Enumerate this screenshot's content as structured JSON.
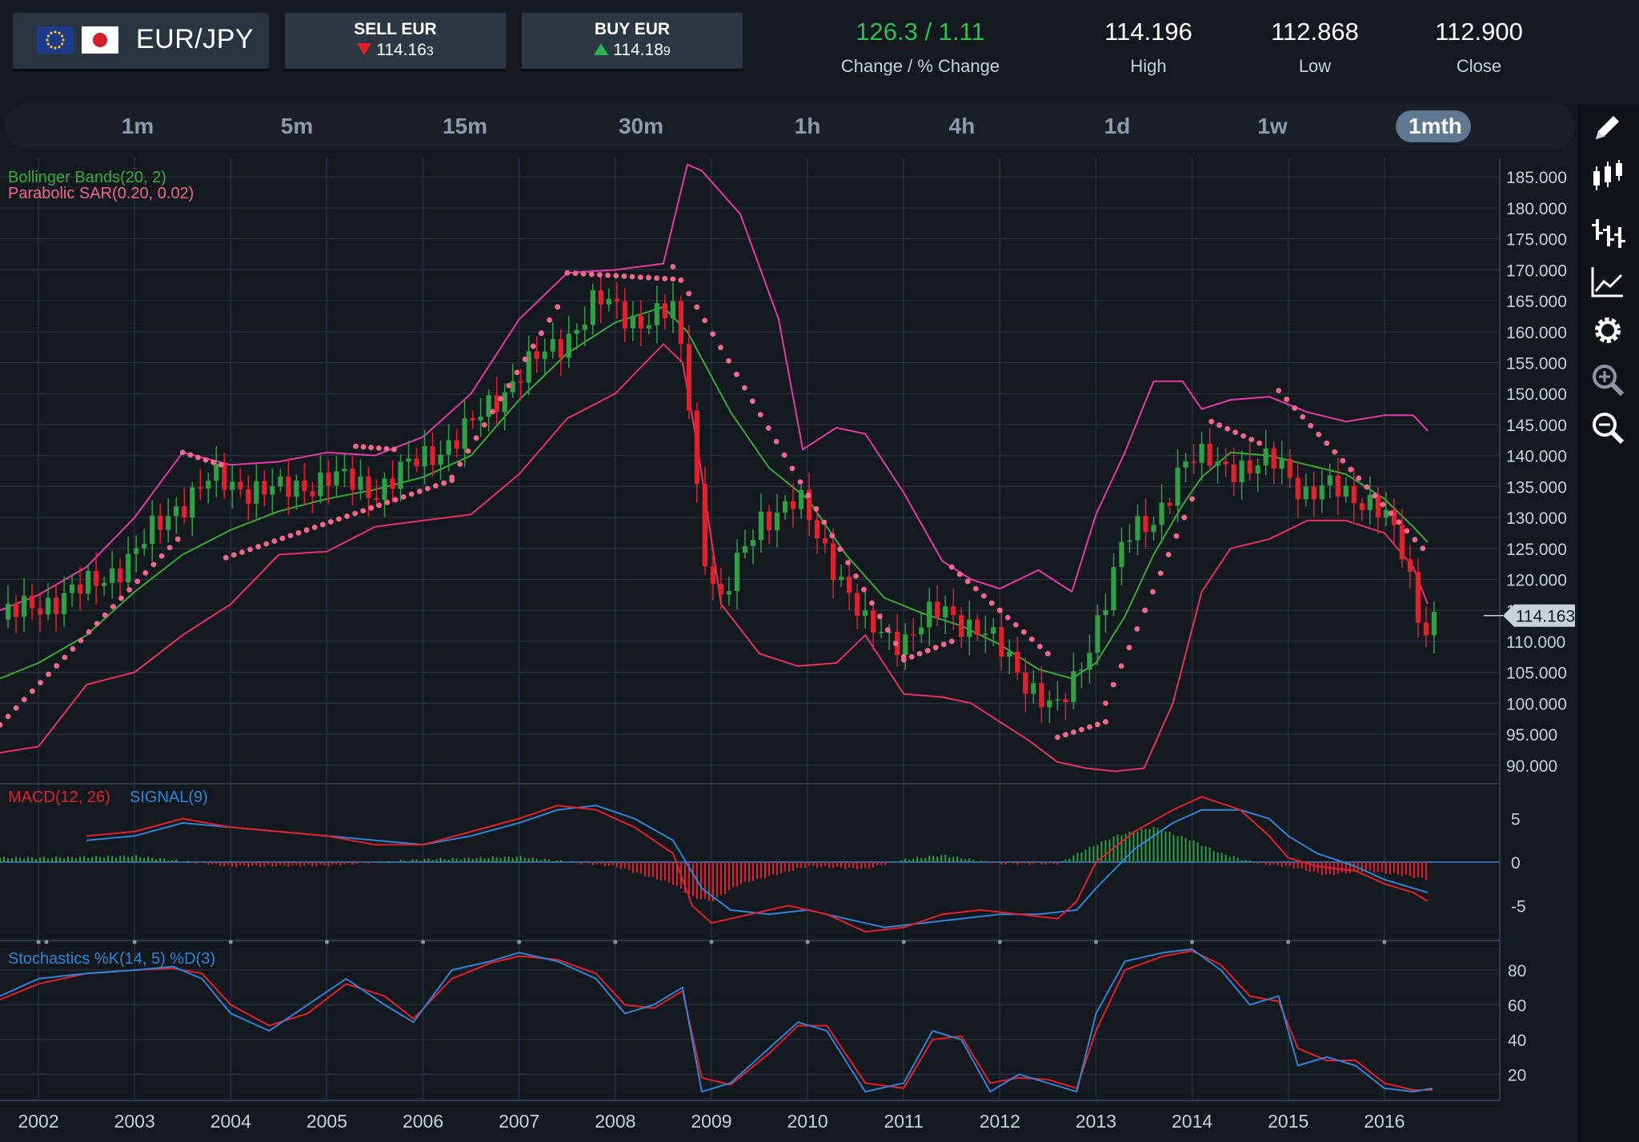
{
  "header": {
    "pair": "EUR/JPY",
    "flags": [
      "eu-flag-icon",
      "jp-flag-icon"
    ],
    "sell": {
      "label": "SELL EUR",
      "price": "114.16",
      "pip": "3"
    },
    "buy": {
      "label": "BUY EUR",
      "price": "114.18",
      "pip": "9"
    },
    "stats": [
      {
        "value": "126.3 / 1.11",
        "label": "Change / % Change",
        "color": "#2fbf5a"
      },
      {
        "value": "114.196",
        "label": "High"
      },
      {
        "value": "112.868",
        "label": "Low"
      },
      {
        "value": "112.900",
        "label": "Close"
      }
    ]
  },
  "timeframes": [
    "1m",
    "5m",
    "15m",
    "30m",
    "1h",
    "4h",
    "1d",
    "1w",
    "1mth"
  ],
  "active_timeframe": "1mth",
  "tools": [
    "pencil-icon",
    "candlestick-icon",
    "ohlc-bars-icon",
    "line-chart-icon",
    "gear-icon",
    "zoom-in-icon",
    "zoom-out-icon"
  ],
  "colors": {
    "up": "#2fa043",
    "down": "#e5202c",
    "bollinger_outer": "#e83aa6",
    "bollinger_mid": "#3caa36",
    "bollinger_lower": "#e8335f",
    "sar": "#f06a8c",
    "macd": "#e5202c",
    "signal": "#2f86d8",
    "stoch_k": "#2f86d8",
    "stoch_d": "#e5202c",
    "grid": "#2a3443",
    "background": "#14181f"
  },
  "chart_data": [
    {
      "type": "candlestick",
      "title": "Bollinger Bands(20, 2)",
      "subtitle": "Parabolic SAR(0.20, 0.02)",
      "indicators": [
        "Bollinger Bands(20, 2)",
        "Parabolic SAR(0.20, 0.02)"
      ],
      "x_ticks": [
        "2002",
        "2003",
        "2004",
        "2005",
        "2006",
        "2007",
        "2008",
        "2009",
        "2010",
        "2011",
        "2012",
        "2013",
        "2014",
        "2015",
        "2016"
      ],
      "y_ticks": [
        "185.000",
        "180.000",
        "175.000",
        "170.000",
        "165.000",
        "160.000",
        "155.000",
        "150.000",
        "145.000",
        "140.000",
        "135.000",
        "130.000",
        "125.000",
        "120.000",
        "115.000",
        "110.000",
        "105.000",
        "100.000",
        "95.000",
        "90.000"
      ],
      "ylim": [
        87,
        188
      ],
      "xlim": [
        2001.6,
        2017.2
      ],
      "last_price_label": "114.163",
      "last_price": 114.163,
      "close_series": {
        "t": [
          2001.6,
          2002.0,
          2002.5,
          2003.0,
          2003.4,
          2003.8,
          2004.5,
          2005.0,
          2005.5,
          2006.0,
          2006.5,
          2007.0,
          2007.4,
          2007.8,
          2008.2,
          2008.6,
          2008.75,
          2008.9,
          2009.1,
          2009.5,
          2009.9,
          2010.3,
          2010.6,
          2011.0,
          2011.4,
          2011.8,
          2012.2,
          2012.6,
          2012.8,
          2013.0,
          2013.3,
          2013.6,
          2013.9,
          2014.2,
          2014.6,
          2014.9,
          2015.2,
          2015.5,
          2015.8,
          2016.0,
          2016.2,
          2016.4,
          2016.55
        ],
        "v": [
          113.5,
          116.0,
          118.5,
          124.0,
          131.5,
          136.0,
          134.0,
          136.5,
          134.5,
          139.5,
          144.5,
          153.5,
          157.5,
          165.0,
          162.0,
          163.0,
          152.0,
          126.0,
          116.0,
          130.0,
          132.5,
          122.0,
          112.0,
          110.5,
          115.0,
          112.0,
          105.0,
          98.5,
          104.0,
          113.0,
          126.0,
          130.0,
          138.0,
          140.0,
          137.0,
          140.0,
          133.0,
          135.0,
          133.0,
          130.0,
          124.0,
          112.0,
          114.2
        ]
      },
      "bollinger_upper": {
        "t": [
          2001.6,
          2002.0,
          2002.5,
          2003.0,
          2003.5,
          2004.0,
          2004.5,
          2005.0,
          2005.5,
          2006.0,
          2006.5,
          2007.0,
          2007.5,
          2008.0,
          2008.5,
          2008.75,
          2008.9,
          2009.3,
          2009.7,
          2009.95,
          2010.3,
          2010.6,
          2011.0,
          2011.4,
          2011.7,
          2012.0,
          2012.4,
          2012.75,
          2013.0,
          2013.3,
          2013.6,
          2013.9,
          2014.1,
          2014.4,
          2014.8,
          2015.2,
          2015.6,
          2016.0,
          2016.3,
          2016.45
        ],
        "v": [
          115.0,
          117.5,
          122.0,
          130.0,
          140.5,
          138.5,
          139.0,
          140.5,
          140.0,
          143.0,
          150.0,
          162.0,
          169.5,
          170.0,
          171.0,
          187.0,
          186.0,
          179.0,
          162.0,
          141.0,
          144.5,
          143.5,
          134.0,
          123.0,
          120.0,
          118.5,
          121.5,
          118.0,
          130.5,
          140.5,
          152.0,
          152.0,
          147.5,
          149.0,
          149.5,
          147.0,
          145.5,
          146.5,
          146.5,
          144.0
        ]
      },
      "bollinger_mid": {
        "t": [
          2001.6,
          2002.0,
          2002.5,
          2003.0,
          2003.5,
          2004.0,
          2004.5,
          2005.0,
          2005.5,
          2006.0,
          2006.5,
          2007.0,
          2007.5,
          2008.0,
          2008.5,
          2008.75,
          2009.2,
          2009.6,
          2010.0,
          2010.4,
          2010.8,
          2011.2,
          2011.6,
          2012.0,
          2012.4,
          2012.75,
          2013.0,
          2013.3,
          2013.6,
          2013.9,
          2014.1,
          2014.4,
          2014.8,
          2015.2,
          2015.6,
          2016.0,
          2016.3,
          2016.45
        ],
        "v": [
          104.0,
          106.5,
          111.0,
          118.0,
          124.0,
          128.0,
          131.0,
          133.0,
          134.5,
          136.5,
          140.0,
          149.0,
          156.5,
          161.5,
          164.0,
          160.0,
          147.0,
          138.0,
          133.0,
          124.0,
          117.0,
          114.5,
          112.5,
          109.5,
          105.5,
          104.0,
          106.5,
          114.0,
          124.0,
          132.0,
          136.5,
          140.5,
          140.0,
          138.5,
          137.0,
          133.0,
          128.5,
          126.0
        ]
      },
      "bollinger_lower": {
        "t": [
          2001.6,
          2002.0,
          2002.5,
          2003.0,
          2003.5,
          2004.0,
          2004.5,
          2005.0,
          2005.5,
          2006.0,
          2006.5,
          2007.0,
          2007.5,
          2008.0,
          2008.5,
          2008.7,
          2008.85,
          2009.1,
          2009.5,
          2009.9,
          2010.3,
          2010.6,
          2011.0,
          2011.4,
          2011.7,
          2012.0,
          2012.3,
          2012.6,
          2012.9,
          2013.2,
          2013.5,
          2013.8,
          2014.1,
          2014.4,
          2014.8,
          2015.2,
          2015.6,
          2016.0,
          2016.3,
          2016.45
        ],
        "v": [
          92.0,
          93.0,
          103.0,
          105.0,
          111.0,
          116.0,
          124.0,
          124.5,
          128.5,
          129.5,
          130.5,
          137.0,
          146.0,
          150.0,
          158.0,
          155.0,
          142.0,
          116.0,
          108.0,
          106.0,
          106.5,
          111.0,
          101.5,
          101.0,
          100.0,
          97.0,
          94.0,
          90.5,
          89.5,
          89.0,
          89.5,
          100.0,
          118.0,
          125.0,
          126.5,
          129.5,
          129.5,
          127.5,
          122.0,
          116.0
        ]
      },
      "sar": {
        "segments": [
          {
            "t0": 2001.6,
            "t1": 2003.45,
            "v0": 96.5,
            "v1": 126.5
          },
          {
            "t0": 2003.5,
            "t1": 2003.9,
            "v0": 140.5,
            "v1": 138.5
          },
          {
            "t0": 2003.95,
            "t1": 2006.3,
            "v0": 123.5,
            "v1": 136.0
          },
          {
            "t0": 2005.3,
            "t1": 2005.7,
            "v0": 141.5,
            "v1": 141.0
          },
          {
            "t0": 2006.3,
            "t1": 2007.4,
            "v0": 136.5,
            "v1": 164.0
          },
          {
            "t0": 2007.5,
            "t1": 2008.6,
            "v0": 169.5,
            "v1": 168.5
          },
          {
            "t0": 2008.6,
            "t1": 2011.0,
            "v0": 170.5,
            "v1": 107.5
          },
          {
            "t0": 2011.0,
            "t1": 2011.5,
            "v0": 107.0,
            "v1": 110.0
          },
          {
            "t0": 2011.5,
            "t1": 2012.5,
            "v0": 122.0,
            "v1": 108.0
          },
          {
            "t0": 2012.6,
            "t1": 2013.1,
            "v0": 94.5,
            "v1": 97.0
          },
          {
            "t0": 2013.1,
            "t1": 2014.0,
            "v0": 100.0,
            "v1": 133.0
          },
          {
            "t0": 2014.2,
            "t1": 2014.7,
            "v0": 145.5,
            "v1": 142.0
          },
          {
            "t0": 2014.9,
            "t1": 2016.4,
            "v0": 150.5,
            "v1": 125.0
          }
        ]
      }
    },
    {
      "type": "line",
      "title": "MACD(12, 26)",
      "series": [
        {
          "name": "MACD(12, 26)",
          "t": [
            2002.5,
            2003.0,
            2003.5,
            2004.0,
            2004.5,
            2005.0,
            2005.5,
            2006.0,
            2006.5,
            2007.0,
            2007.4,
            2007.8,
            2008.2,
            2008.6,
            2008.8,
            2009.0,
            2009.4,
            2009.8,
            2010.2,
            2010.6,
            2011.0,
            2011.4,
            2011.8,
            2012.2,
            2012.6,
            2012.8,
            2013.0,
            2013.4,
            2013.8,
            2014.1,
            2014.5,
            2014.8,
            2015.0,
            2015.3,
            2015.7,
            2016.0,
            2016.3,
            2016.45
          ],
          "v": [
            3.0,
            3.5,
            5.0,
            4.0,
            3.5,
            3.0,
            2.0,
            2.0,
            3.5,
            5.0,
            6.5,
            6.0,
            4.0,
            1.0,
            -5.0,
            -7.0,
            -6.0,
            -5.0,
            -6.0,
            -8.0,
            -7.5,
            -6.0,
            -5.5,
            -6.0,
            -6.5,
            -4.5,
            0.0,
            3.5,
            6.0,
            7.5,
            6.0,
            3.0,
            0.5,
            -0.5,
            -1.0,
            -2.5,
            -3.5,
            -4.5
          ]
        },
        {
          "name": "SIGNAL(9)",
          "t": [
            2002.5,
            2003.0,
            2003.5,
            2004.0,
            2004.5,
            2005.0,
            2005.5,
            2006.0,
            2006.5,
            2007.0,
            2007.4,
            2007.8,
            2008.2,
            2008.6,
            2008.9,
            2009.2,
            2009.6,
            2010.0,
            2010.4,
            2010.8,
            2011.2,
            2011.6,
            2012.0,
            2012.4,
            2012.8,
            2013.0,
            2013.4,
            2013.8,
            2014.1,
            2014.5,
            2014.8,
            2015.0,
            2015.3,
            2015.7,
            2016.0,
            2016.3,
            2016.45
          ],
          "v": [
            2.5,
            3.0,
            4.5,
            4.0,
            3.5,
            3.0,
            2.5,
            2.0,
            3.0,
            4.5,
            6.0,
            6.5,
            5.0,
            2.5,
            -3.0,
            -5.5,
            -6.0,
            -5.5,
            -6.5,
            -7.5,
            -7.0,
            -6.5,
            -6.0,
            -6.0,
            -5.5,
            -3.0,
            1.5,
            4.5,
            6.0,
            6.0,
            5.0,
            3.0,
            1.0,
            -0.5,
            -2.0,
            -3.0,
            -3.5
          ]
        }
      ],
      "histogram": {
        "t": [
          2002.0,
          2003.0,
          2004.0,
          2005.0,
          2006.0,
          2007.0,
          2008.0,
          2008.6,
          2008.8,
          2009.0,
          2009.3,
          2010.0,
          2010.6,
          2011.0,
          2011.4,
          2012.0,
          2012.6,
          2012.9,
          2013.2,
          2013.6,
          2014.0,
          2014.3,
          2014.7,
          2015.0,
          2015.4,
          2015.8,
          2016.2,
          2016.45
        ],
        "v": [
          0.5,
          0.7,
          -0.5,
          -0.4,
          0.3,
          0.6,
          -0.5,
          -2.5,
          -4.0,
          -4.5,
          -2.5,
          -0.5,
          -0.8,
          0.3,
          0.8,
          -0.2,
          -0.2,
          1.5,
          3.0,
          4.0,
          2.5,
          1.0,
          -0.2,
          -0.5,
          -1.5,
          -1.0,
          -1.5,
          -2.0
        ]
      },
      "y_ticks": [
        "5",
        "0",
        "-5"
      ],
      "ylim": [
        -9,
        9
      ]
    },
    {
      "type": "line",
      "title": "Stochastics %K(14, 5)  %D(3)",
      "series": [
        {
          "name": "%K(14, 5)",
          "t": [
            2001.6,
            2002.0,
            2002.5,
            2003.0,
            2003.4,
            2003.7,
            2004.0,
            2004.4,
            2004.8,
            2005.2,
            2005.6,
            2005.9,
            2006.3,
            2006.7,
            2007.0,
            2007.4,
            2007.8,
            2008.1,
            2008.4,
            2008.7,
            2008.9,
            2009.2,
            2009.6,
            2009.9,
            2010.2,
            2010.6,
            2011.0,
            2011.3,
            2011.6,
            2011.9,
            2012.2,
            2012.5,
            2012.8,
            2013.0,
            2013.3,
            2013.7,
            2014.0,
            2014.3,
            2014.6,
            2014.9,
            2015.1,
            2015.4,
            2015.7,
            2016.0,
            2016.3,
            2016.5
          ],
          "v": [
            65,
            75,
            78,
            80,
            82,
            75,
            55,
            45,
            60,
            75,
            60,
            50,
            80,
            85,
            90,
            85,
            75,
            55,
            60,
            70,
            10,
            15,
            35,
            50,
            45,
            10,
            15,
            45,
            40,
            10,
            20,
            15,
            10,
            55,
            85,
            90,
            92,
            80,
            60,
            65,
            25,
            30,
            25,
            12,
            10,
            12
          ]
        },
        {
          "name": "%D(3)",
          "t": [
            2001.6,
            2002.0,
            2002.5,
            2003.0,
            2003.4,
            2003.7,
            2004.0,
            2004.4,
            2004.8,
            2005.2,
            2005.6,
            2005.9,
            2006.3,
            2006.7,
            2007.0,
            2007.4,
            2007.8,
            2008.1,
            2008.4,
            2008.7,
            2008.9,
            2009.2,
            2009.6,
            2009.9,
            2010.2,
            2010.6,
            2011.0,
            2011.3,
            2011.6,
            2011.9,
            2012.2,
            2012.5,
            2012.8,
            2013.0,
            2013.3,
            2013.7,
            2014.0,
            2014.3,
            2014.6,
            2014.9,
            2015.1,
            2015.4,
            2015.7,
            2016.0,
            2016.3,
            2016.5
          ],
          "v": [
            63,
            72,
            78,
            80,
            81,
            78,
            60,
            48,
            55,
            72,
            65,
            52,
            75,
            84,
            88,
            86,
            78,
            60,
            58,
            68,
            18,
            14,
            32,
            48,
            48,
            15,
            12,
            40,
            42,
            15,
            18,
            17,
            12,
            45,
            80,
            88,
            91,
            83,
            65,
            62,
            35,
            28,
            28,
            15,
            11,
            11
          ]
        }
      ],
      "y_ticks": [
        "80",
        "60",
        "40",
        "20"
      ],
      "ylim": [
        5,
        97
      ]
    }
  ],
  "macd_label": "MACD(12, 26)",
  "signal_label": "SIGNAL(9)",
  "stoch_label": "Stochastics %K(14, 5)  %D(3)"
}
